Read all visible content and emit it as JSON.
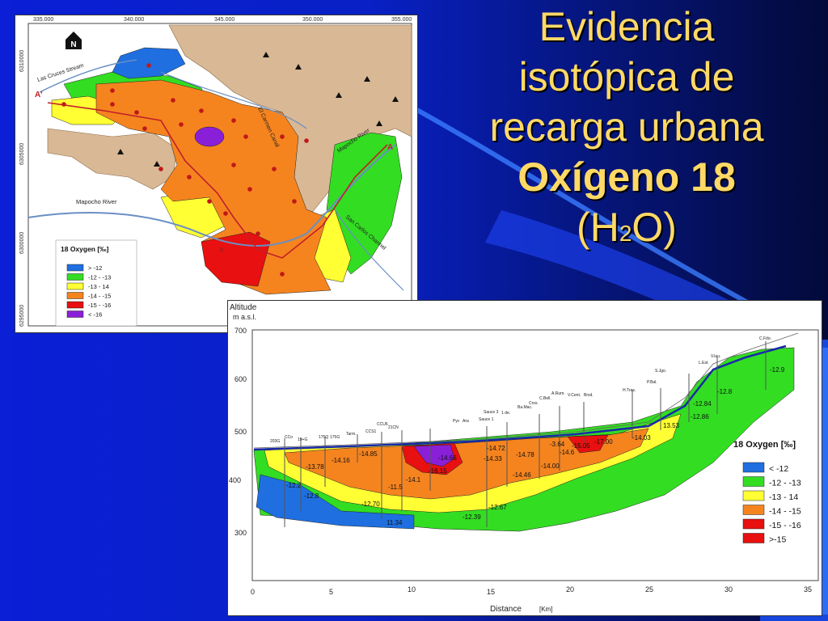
{
  "slide": {
    "title_line1": "Evidencia",
    "title_line2": "isotópica de",
    "title_line3": "recarga urbana",
    "title_line4": "Oxígeno 18",
    "title_line5_pre": "(H",
    "title_line5_sub": "2",
    "title_line5_post": "O)"
  },
  "map": {
    "x_ticks": [
      "335.000",
      "340.000",
      "345.000",
      "350.000",
      "355.000"
    ],
    "y_ticks": [
      "6310000",
      "6305000",
      "6300000",
      "6295000"
    ],
    "north": "N",
    "labels": {
      "las_cruces": "Las Cruces Stream",
      "el_carmen": "El Carmen Canal",
      "mapocho_river_top": "Mapocho River",
      "mapocho_river_left": "Mapocho River",
      "san_carlos": "San Carlos Channel",
      "a_prime": "A'",
      "a": "A"
    },
    "legend_title": "18 Oxygen [‰]",
    "legend": [
      {
        "label": "> -12",
        "color": "#1f6fe0"
      },
      {
        "label": "-12 - -13",
        "color": "#33dd22"
      },
      {
        "label": "-13 - 14",
        "color": "#ffff33"
      },
      {
        "label": "-14 - -15",
        "color": "#f5841f"
      },
      {
        "label": "-15 - -16",
        "color": "#e81010"
      },
      {
        "label": "< -16",
        "color": "#8a1fd8"
      }
    ]
  },
  "section": {
    "y_axis_title": "Altitude",
    "y_axis_unit": "m a.s.l.",
    "y_ticks": [
      "700",
      "600",
      "500",
      "400",
      "300"
    ],
    "x_ticks": [
      "0",
      "5",
      "10",
      "15",
      "20",
      "25",
      "30",
      "35"
    ],
    "x_axis_title": "Distance",
    "x_axis_unit": "[Km]",
    "legend_title": "18 Oxygen [‰]",
    "legend": [
      {
        "label": "< -12",
        "color": "#1f6fe0"
      },
      {
        "label": "-12 - -13",
        "color": "#33dd22"
      },
      {
        "label": "-13 - 14",
        "color": "#ffff33"
      },
      {
        "label": "-14 - -15",
        "color": "#f5841f"
      },
      {
        "label": "-15 - -16",
        "color": "#e81010"
      },
      {
        "label": ">-15",
        "color": "#e81010"
      }
    ],
    "values": [
      "-12.9",
      "-12.8",
      "-12.84",
      "-12.86",
      "13.53",
      "-14.03",
      "-17.00",
      "-15.05",
      "-14.6",
      "-3.64",
      "-14.00",
      "-14.78",
      "-14.46",
      "-14.72",
      "-14.33",
      "-14.66",
      "-16.15",
      "-14.1",
      "-14.85",
      "-14.16",
      "-13.78",
      "-12.2",
      "-12.8",
      "-12.70",
      "-11.5",
      "11.34",
      "-12.39",
      "-12.67"
    ],
    "well_labels": [
      "C.Fdo.",
      "V.lau.",
      "L.Est.",
      "S.Jgo.",
      "P.Bal.",
      "H.Tras.",
      "Brsd.",
      "V.Cent.",
      "A.Rum.",
      "C.Bell.",
      "Cros.",
      "Ba.Mac.",
      "Sauce 3",
      "Sauce 1",
      "Pyc",
      "Ara",
      "1 de.",
      "21CN",
      "CCU6",
      "CCS1",
      "Tarm.",
      "175Q",
      "175G",
      "19+G",
      "CCo",
      "203G"
    ]
  }
}
